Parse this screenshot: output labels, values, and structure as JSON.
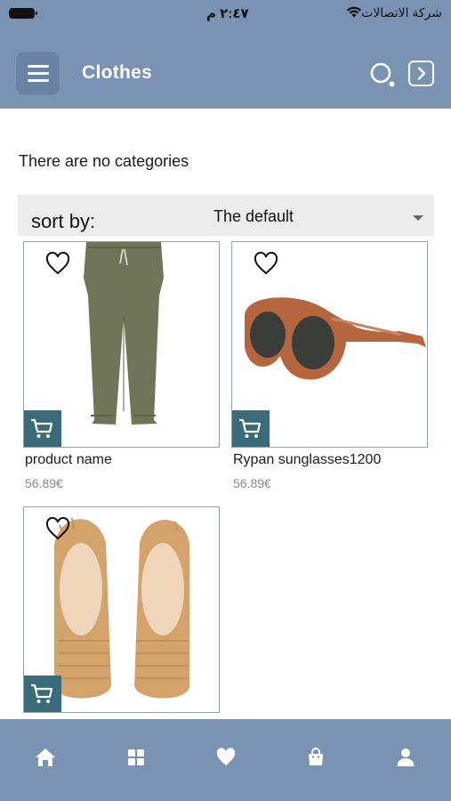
{
  "status_bar": {
    "time": "٢:٤٧ م",
    "carrier": "شركة الاتصالات"
  },
  "app_bar": {
    "title": "Clothes"
  },
  "content": {
    "empty_categories_text": "There are no categories",
    "sort": {
      "label": "sort by:",
      "selected": "The default"
    },
    "products": [
      {
        "name": "product name",
        "price": "56.89€",
        "image": "olive-jogger-pants"
      },
      {
        "name": "Rypan sunglasses1200",
        "price": "56.89€",
        "image": "tortoise-sunglasses"
      },
      {
        "name": "",
        "price": "",
        "image": "tan-croc-loafers"
      }
    ]
  },
  "bottom_nav": {
    "items": [
      "home-icon",
      "grid-icon",
      "heart-icon",
      "bag-icon",
      "user-icon"
    ]
  },
  "colors": {
    "bar": "#7a93b3",
    "menu_button": "#6a83a4",
    "cart_button": "#3a6b78",
    "sort_bg": "#ececec"
  }
}
